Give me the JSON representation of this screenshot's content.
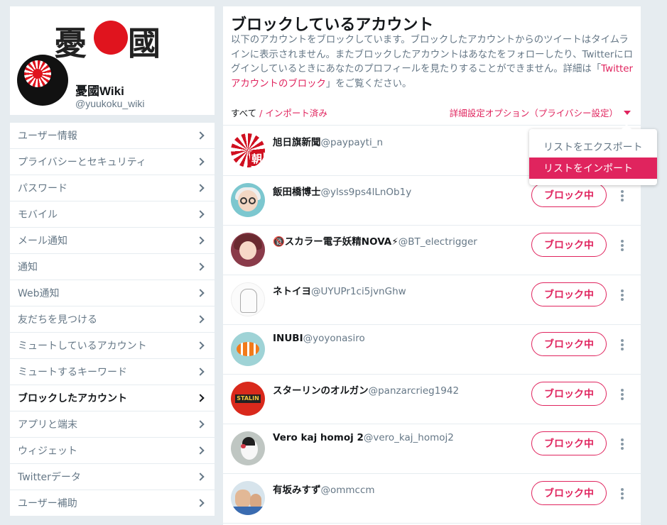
{
  "profile": {
    "banner_kanji_left": "憂",
    "banner_kanji_right": "國",
    "name": "憂國Wiki",
    "handle": "@yuukoku_wiki"
  },
  "sidebar": {
    "items": [
      {
        "label": "ユーザー情報"
      },
      {
        "label": "プライバシーとセキュリティ"
      },
      {
        "label": "パスワード"
      },
      {
        "label": "モバイル"
      },
      {
        "label": "メール通知"
      },
      {
        "label": "通知"
      },
      {
        "label": "Web通知"
      },
      {
        "label": "友だちを見つける"
      },
      {
        "label": "ミュートしているアカウント"
      },
      {
        "label": "ミュートするキーワード"
      },
      {
        "label": "ブロックしたアカウント"
      },
      {
        "label": "アプリと端末"
      },
      {
        "label": "ウィジェット"
      },
      {
        "label": "Twitterデータ"
      },
      {
        "label": "ユーザー補助"
      }
    ],
    "active_index": 10
  },
  "main": {
    "title": "ブロックしているアカウント",
    "description_1": "以下のアカウントをブロックしています。ブロックしたアカウントからのツイートはタイムラインに表示されません。またブロックしたアカウントはあなたをフォローしたり、Twitterにログインしているときにあなたのプロフィールを見たりすることができません。詳細は「",
    "description_link": "Twitterアカウントのブロック",
    "description_2": "」をご覧ください。",
    "filter_all": "すべて",
    "filter_sep": " / ",
    "filter_imported": "インポート済み",
    "advanced_options": "詳細設定オプション（プライバシー設定）"
  },
  "dropdown": {
    "export": "リストをエクスポート",
    "import": "リストをインポート"
  },
  "accounts": [
    {
      "name": "旭日旗新聞",
      "handle": "@paypayti_n",
      "button": "ブロック中",
      "avatar_text": "朝"
    },
    {
      "name": "飯田橋博士",
      "handle": "@ylss9ps4lLnOb1y",
      "button": "ブロック中"
    },
    {
      "name": "🔞スカラー電子妖精NOVA⚡",
      "handle": "@BT_electrigger",
      "button": "ブロック中"
    },
    {
      "name": "ネトイヨ",
      "handle": "@UYUPr1ci5jvnGhw",
      "button": "ブロック中"
    },
    {
      "name": "INUBI",
      "handle": "@yoyonasiro",
      "button": "ブロック中"
    },
    {
      "name": "スターリンのオルガン",
      "handle": "@panzarcrieg1942",
      "button": "ブロック中",
      "avatar_text": "STALIN"
    },
    {
      "name": "Vero kaj homoj 2",
      "handle": "@vero_kaj_homoj2",
      "button": "ブロック中"
    },
    {
      "name": "有坂みすず",
      "handle": "@ommccm",
      "button": "ブロック中"
    }
  ],
  "colors": {
    "accent": "#e0245e",
    "text_secondary": "#657786",
    "background": "#e6ecf0"
  }
}
